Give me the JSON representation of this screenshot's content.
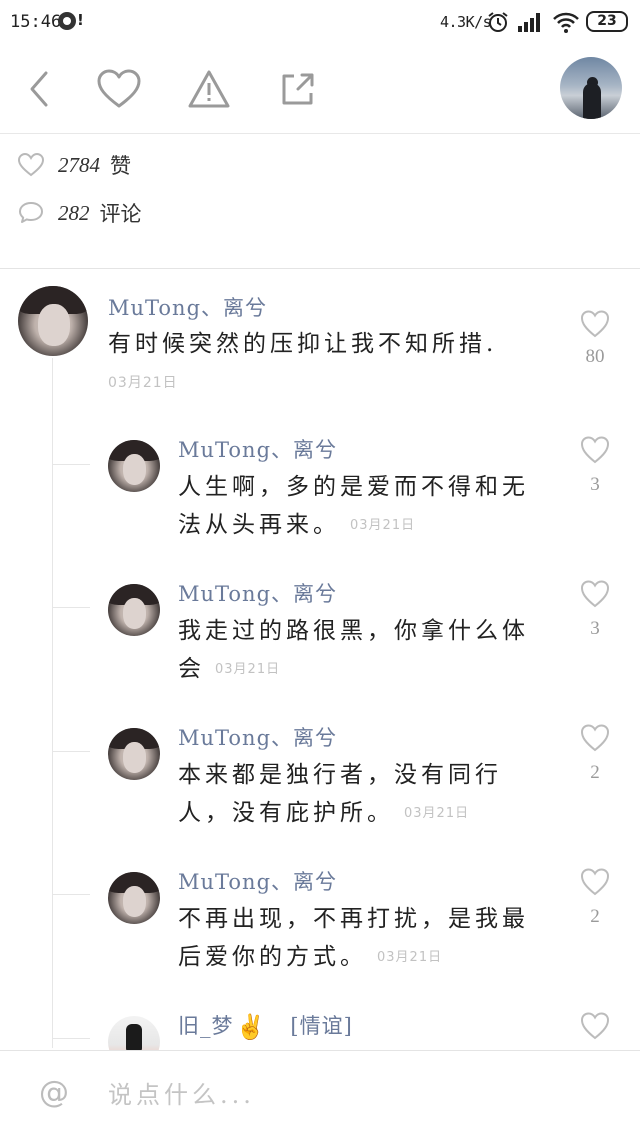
{
  "status_bar": {
    "time": "15:46",
    "notice": "!",
    "net_speed": "4.3K/s",
    "battery": "23"
  },
  "toolbar": {
    "icons": [
      "back-icon",
      "heart-icon",
      "warning-icon",
      "share-icon"
    ]
  },
  "stats": {
    "likes_count": "2784",
    "likes_label": "赞",
    "comments_count": "282",
    "comments_label": "评论"
  },
  "comments": {
    "main": {
      "author": "MuTong、离兮",
      "text": "有时候突然的压抑让我不知所措.",
      "time": "03月21日",
      "likes": "80"
    },
    "replies": [
      {
        "author": "MuTong、离兮",
        "line1": "人生啊，多的是爱而不得和无",
        "line2": "法从头再来。",
        "time": "03月21日",
        "likes": "3"
      },
      {
        "author": "MuTong、离兮",
        "line1": "我走过的路很黑，你拿什么体",
        "line2": "会",
        "time": "03月21日",
        "likes": "3"
      },
      {
        "author": "MuTong、离兮",
        "line1": "本来都是独行者，没有同行",
        "line2": "人，没有庇护所。",
        "time": "03月21日",
        "likes": "2"
      },
      {
        "author": "MuTong、离兮",
        "line1": "不再出现，不再打扰，是我最",
        "line2": "后爱你的方式。",
        "time": "03月21日",
        "likes": "2"
      }
    ],
    "partial": {
      "author": "旧_梦",
      "emoji": "✌",
      "tag": "[情谊]"
    }
  },
  "composer": {
    "placeholder": "说点什么..."
  },
  "colors": {
    "name_color": "#6a7a9a",
    "icon_gray": "#b9b9b9",
    "divider": "#e6e6e6"
  }
}
